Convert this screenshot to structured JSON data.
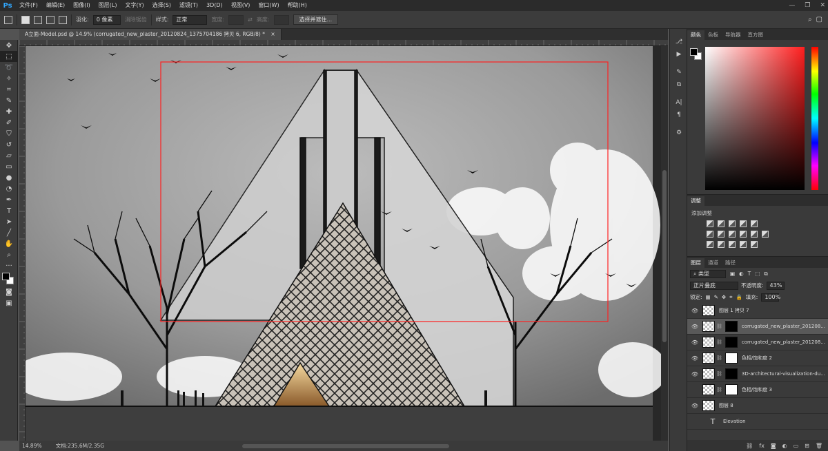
{
  "app": {
    "logo": "Ps"
  },
  "menu": [
    "文件(F)",
    "编辑(E)",
    "图像(I)",
    "图层(L)",
    "文字(Y)",
    "选择(S)",
    "滤镜(T)",
    "3D(D)",
    "视图(V)",
    "窗口(W)",
    "帮助(H)"
  ],
  "window_controls": [
    "—",
    "❐",
    "✕"
  ],
  "options": {
    "feather_label": "羽化:",
    "feather_value": "0 像素",
    "antialias": "消除锯齿",
    "style_label": "样式:",
    "style_value": "正常",
    "width_label": "宽度:",
    "height_label": "高度:",
    "select_mask_button": "选择并遮住..."
  },
  "document_tab": {
    "title": "A立面-Model.psd @ 14.9% (corrugated_new_plaster_20120824_1375704186 拷贝 6, RGB/8) *",
    "close": "×"
  },
  "status": {
    "zoom": "14.89%",
    "doc": "文档:235.6M/2.35G"
  },
  "panels": {
    "color_tabs": [
      "颜色",
      "色板",
      "导航器",
      "直方图"
    ],
    "adjust_tab": "调整",
    "adjust_add": "添加调整",
    "layer_tabs": [
      "图层",
      "通道",
      "路径"
    ],
    "kind_filter": "类型",
    "blend_mode": "正片叠底",
    "opacity_label": "不透明度:",
    "opacity_value": "43%",
    "lock_label": "锁定:",
    "fill_label": "填充:",
    "fill_value": "100%"
  },
  "layers": [
    {
      "name": "图层 1 拷贝 7",
      "visible": true,
      "mask": "none",
      "selected": false
    },
    {
      "name": "corrugated_new_plaster_201208...",
      "visible": true,
      "mask": "black",
      "selected": true
    },
    {
      "name": "corrugated_new_plaster_201208...",
      "visible": true,
      "mask": "black",
      "selected": false
    },
    {
      "name": "色相/饱和度 2",
      "visible": true,
      "mask": "white",
      "selected": false
    },
    {
      "name": "3D-architectural-visualization-du...",
      "visible": true,
      "mask": "black",
      "selected": false
    },
    {
      "name": "色相/饱和度 3",
      "visible": false,
      "mask": "white",
      "selected": false
    },
    {
      "name": "图层 8",
      "visible": true,
      "mask": "none",
      "selected": false
    },
    {
      "name": "Elevation",
      "visible": false,
      "mask": "text",
      "selected": false
    }
  ],
  "colors": {
    "selection": "#ff2020",
    "accent": "#31a8ff",
    "fg": "#000000",
    "bg": "#ffffff"
  }
}
